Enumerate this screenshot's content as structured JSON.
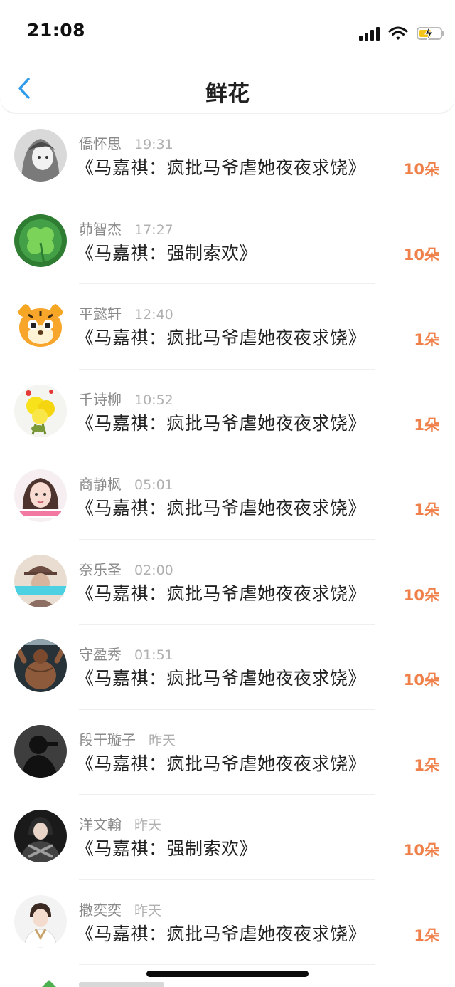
{
  "status_bar": {
    "time": "21:08"
  },
  "nav": {
    "title": "鲜花"
  },
  "rows": [
    {
      "name": "僑怀思",
      "time": "19:31",
      "title": "《马嘉祺：疯批马爷虐她夜夜求饶》",
      "count": "10朵",
      "avatar": "grey-girl"
    },
    {
      "name": "茆智杰",
      "time": "17:27",
      "title": "《马嘉祺：强制索欢》",
      "count": "10朵",
      "avatar": "clover"
    },
    {
      "name": "平懿轩",
      "time": "12:40",
      "title": "《马嘉祺：疯批马爷虐她夜夜求饶》",
      "count": "1朵",
      "avatar": "tiger"
    },
    {
      "name": "千诗柳",
      "time": "10:52",
      "title": "《马嘉祺：疯批马爷虐她夜夜求饶》",
      "count": "1朵",
      "avatar": "flowers"
    },
    {
      "name": "商静枫",
      "time": "05:01",
      "title": "《马嘉祺：疯批马爷虐她夜夜求饶》",
      "count": "1朵",
      "avatar": "girl"
    },
    {
      "name": "奈乐圣",
      "time": "02:00",
      "title": "《马嘉祺：疯批马爷虐她夜夜求饶》",
      "count": "10朵",
      "avatar": "hat-man"
    },
    {
      "name": "守盈秀",
      "time": "01:51",
      "title": "《马嘉祺：疯批马爷虐她夜夜求饶》",
      "count": "10朵",
      "avatar": "muscle"
    },
    {
      "name": "段干璇子",
      "time": "昨天",
      "title": "《马嘉祺：疯批马爷虐她夜夜求饶》",
      "count": "1朵",
      "avatar": "silhouette"
    },
    {
      "name": "洋文翰",
      "time": "昨天",
      "title": "《马嘉祺：强制索欢》",
      "count": "10朵",
      "avatar": "armor"
    },
    {
      "name": "撒奕奕",
      "time": "昨天",
      "title": "《马嘉祺：疯批马爷虐她夜夜求饶》",
      "count": "1朵",
      "avatar": "boy"
    }
  ]
}
